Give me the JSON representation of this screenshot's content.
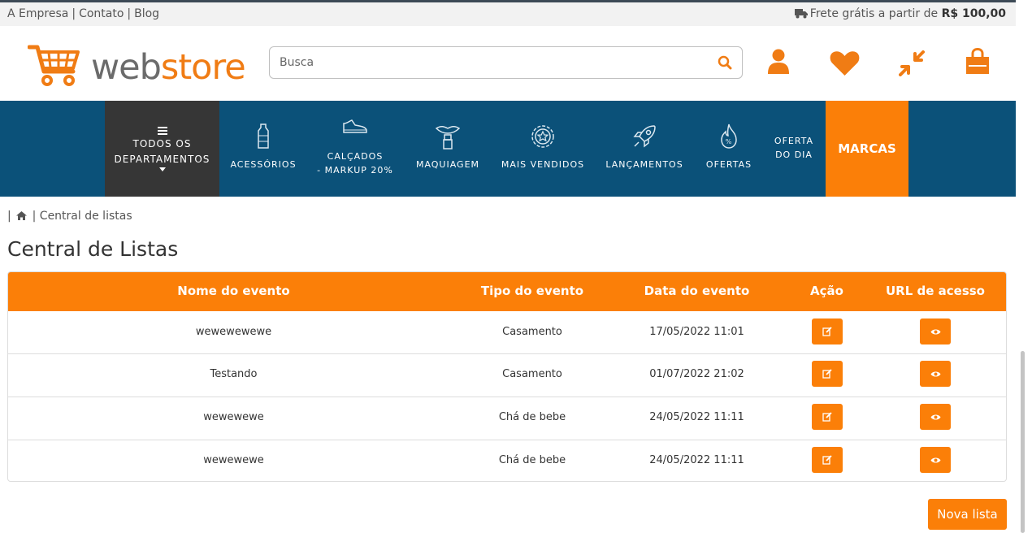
{
  "topbar": {
    "links": [
      "A Empresa",
      "Contato",
      "Blog"
    ],
    "frete_text": "Frete grátis a partir de",
    "frete_value": "R$ 100,00"
  },
  "logo": {
    "part1": "web",
    "part2": "store"
  },
  "search": {
    "placeholder": "Busca",
    "value": ""
  },
  "header_icons": [
    "user-icon",
    "heart-icon",
    "compress-icon",
    "shopping-bag-icon"
  ],
  "nav": {
    "all_departments": {
      "line1": "TODOS OS",
      "line2": "DEPARTAMENTOS"
    },
    "items": [
      {
        "label": "ACESSÓRIOS",
        "icon": "bottle-icon"
      },
      {
        "label1": "CALÇADOS",
        "label2": "- MARKUP 20%",
        "icon": "shoe-icon"
      },
      {
        "label": "MAQUIAGEM",
        "icon": "lipstick-icon"
      },
      {
        "label": "MAIS VENDIDOS",
        "icon": "star-badge-icon"
      },
      {
        "label": "LANÇAMENTOS",
        "icon": "rocket-icon"
      },
      {
        "label": "OFERTAS",
        "icon": "fire-percent-icon"
      },
      {
        "label1": "OFERTA",
        "label2": "DO DIA"
      }
    ],
    "marcas": "MARCAS"
  },
  "breadcrumb": {
    "current": "Central de listas"
  },
  "page_title": "Central de Listas",
  "table": {
    "headers": [
      "Nome do evento",
      "Tipo do evento",
      "Data do evento",
      "Ação",
      "URL de acesso"
    ],
    "rows": [
      {
        "nome": "wewewewewe",
        "tipo": "Casamento",
        "data": "17/05/2022 11:01"
      },
      {
        "nome": "Testando",
        "tipo": "Casamento",
        "data": "01/07/2022 21:02"
      },
      {
        "nome": "wewewewe",
        "tipo": "Chá de bebe",
        "data": "24/05/2022 11:11"
      },
      {
        "nome": "wewewewe",
        "tipo": "Chá de bebe",
        "data": "24/05/2022 11:11"
      }
    ]
  },
  "buttons": {
    "nova_lista": "Nova lista"
  },
  "colors": {
    "accent": "#fb7f08",
    "nav_bg": "#0b5179",
    "dept_bg": "#363636"
  }
}
